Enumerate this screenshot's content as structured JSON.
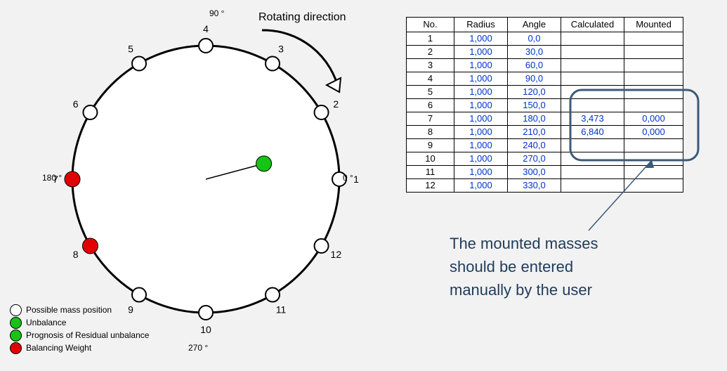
{
  "annotation": {
    "rotating_direction": "Rotating direction",
    "note_line1": "The mounted masses",
    "note_line2": "should be entered",
    "note_line3": "manually by the user"
  },
  "axis_ticks": {
    "top": "90 °",
    "right": "0 °",
    "bottom": "270 °",
    "left": "180 °"
  },
  "legend": {
    "possible": "Possible mass position",
    "unbalance": "Unbalance",
    "prognosis": "Prognosis of Residual unbalance",
    "balancing": "Balancing Weight"
  },
  "diagram": {
    "positions": [
      {
        "n": "1",
        "deg": 0
      },
      {
        "n": "2",
        "deg": 30
      },
      {
        "n": "3",
        "deg": 60
      },
      {
        "n": "4",
        "deg": 90
      },
      {
        "n": "5",
        "deg": 120
      },
      {
        "n": "6",
        "deg": 150
      },
      {
        "n": "7",
        "deg": 180
      },
      {
        "n": "8",
        "deg": 210
      },
      {
        "n": "9",
        "deg": 240
      },
      {
        "n": "10",
        "deg": 270
      },
      {
        "n": "11",
        "deg": 300
      },
      {
        "n": "12",
        "deg": 330
      }
    ],
    "unbalance_vector": {
      "deg": 15,
      "r_frac": 0.45
    },
    "balancing_weights": [
      {
        "deg": 180,
        "r_frac": 1.0
      },
      {
        "deg": 210,
        "r_frac": 1.0
      }
    ]
  },
  "table": {
    "headers": {
      "no": "No.",
      "radius": "Radius",
      "angle": "Angle",
      "calculated": "Calculated",
      "mounted": "Mounted"
    },
    "rows": [
      {
        "no": "1",
        "radius": "1,000",
        "angle": "0,0",
        "calculated": "",
        "mounted": ""
      },
      {
        "no": "2",
        "radius": "1,000",
        "angle": "30,0",
        "calculated": "",
        "mounted": ""
      },
      {
        "no": "3",
        "radius": "1,000",
        "angle": "60,0",
        "calculated": "",
        "mounted": ""
      },
      {
        "no": "4",
        "radius": "1,000",
        "angle": "90,0",
        "calculated": "",
        "mounted": ""
      },
      {
        "no": "5",
        "radius": "1,000",
        "angle": "120,0",
        "calculated": "",
        "mounted": ""
      },
      {
        "no": "6",
        "radius": "1,000",
        "angle": "150,0",
        "calculated": "",
        "mounted": ""
      },
      {
        "no": "7",
        "radius": "1,000",
        "angle": "180,0",
        "calculated": "3,473",
        "mounted": "0,000"
      },
      {
        "no": "8",
        "radius": "1,000",
        "angle": "210,0",
        "calculated": "6,840",
        "mounted": "0,000"
      },
      {
        "no": "9",
        "radius": "1,000",
        "angle": "240,0",
        "calculated": "",
        "mounted": ""
      },
      {
        "no": "10",
        "radius": "1,000",
        "angle": "270,0",
        "calculated": "",
        "mounted": ""
      },
      {
        "no": "11",
        "radius": "1,000",
        "angle": "300,0",
        "calculated": "",
        "mounted": ""
      },
      {
        "no": "12",
        "radius": "1,000",
        "angle": "330,0",
        "calculated": "",
        "mounted": ""
      }
    ]
  },
  "chart_data": {
    "type": "scatter",
    "title": "",
    "series": [
      {
        "name": "Possible mass position",
        "type": "polar-points",
        "angles_deg": [
          0,
          30,
          60,
          90,
          120,
          150,
          180,
          210,
          240,
          270,
          300,
          330
        ],
        "radius": 1.0
      },
      {
        "name": "Unbalance",
        "type": "polar-vector",
        "angle_deg": 15,
        "radius": 0.45
      },
      {
        "name": "Balancing Weight",
        "type": "polar-points",
        "angles_deg": [
          180,
          210
        ],
        "radius": 1.0
      }
    ],
    "angle_axis_ticks": [
      0,
      90,
      180,
      270
    ]
  }
}
